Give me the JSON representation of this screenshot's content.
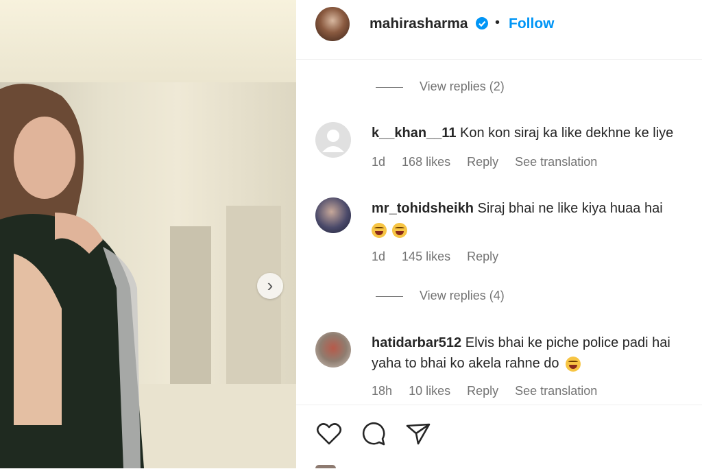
{
  "post": {
    "username": "mahirasharma",
    "dot": "•",
    "follow_label": "Follow",
    "verified": true
  },
  "replies_1": {
    "label": "View replies (2)"
  },
  "comments": [
    {
      "username": "k__khan__11",
      "text": "Kon kon siraj ka like dekhne ke liye",
      "emoji_line": "",
      "time": "1d",
      "likes": "168 likes",
      "reply": "Reply",
      "translate": "See translation"
    },
    {
      "username": "mr_tohidsheikh",
      "text": "Siraj bhai ne like kiya huaa hai",
      "time": "1d",
      "likes": "145 likes",
      "reply": "Reply"
    },
    {
      "username": "hatidarbar512",
      "text": "Elvis bhai ke piche police padi hai",
      "text_line2": "yaha to bhai ko akela rahne do",
      "time": "18h",
      "likes": "10 likes",
      "reply": "Reply",
      "translate": "See translation"
    }
  ],
  "replies_2": {
    "label": "View replies (4)"
  },
  "icons": {
    "like": "heart-icon",
    "comment": "comment-icon",
    "share": "share-icon",
    "next": "chevron-right-icon"
  },
  "colors": {
    "link": "#0095f6",
    "muted": "#737373",
    "text": "#262626"
  }
}
